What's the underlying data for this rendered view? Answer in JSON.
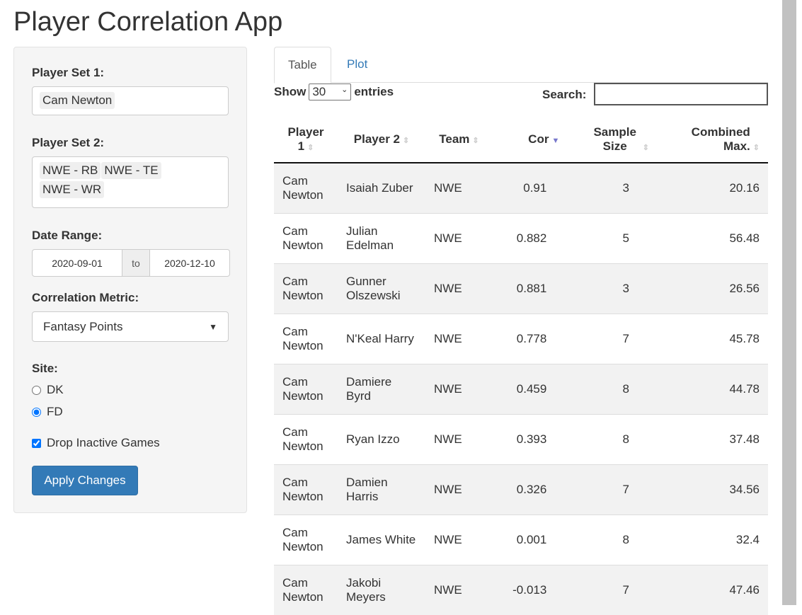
{
  "title": "Player Correlation App",
  "sidebar": {
    "set1_label": "Player Set 1:",
    "set1": [
      "Cam Newton"
    ],
    "set2_label": "Player Set 2:",
    "set2": [
      "NWE - RB",
      "NWE - TE",
      "NWE - WR"
    ],
    "date_label": "Date Range:",
    "date_start": "2020-09-01",
    "date_to": "to",
    "date_end": "2020-12-10",
    "metric_label": "Correlation Metric:",
    "metric": "Fantasy Points",
    "site_label": "Site:",
    "site_options": [
      "DK",
      "FD"
    ],
    "site_selected": "FD",
    "drop_label": "Drop Inactive Games",
    "drop_checked": true,
    "apply": "Apply Changes"
  },
  "tabs": [
    "Table",
    "Plot"
  ],
  "table": {
    "show": "Show",
    "length": "30",
    "entries": "entries",
    "search": "Search:",
    "columns": [
      "Player 1",
      "Player 2",
      "Team",
      "Cor",
      "Sample Size",
      "Combined Max."
    ],
    "rows": [
      [
        "Cam Newton",
        "Isaiah Zuber",
        "NWE",
        "0.91",
        "3",
        "20.16"
      ],
      [
        "Cam Newton",
        "Julian Edelman",
        "NWE",
        "0.882",
        "5",
        "56.48"
      ],
      [
        "Cam Newton",
        "Gunner Olszewski",
        "NWE",
        "0.881",
        "3",
        "26.56"
      ],
      [
        "Cam Newton",
        "N'Keal Harry",
        "NWE",
        "0.778",
        "7",
        "45.78"
      ],
      [
        "Cam Newton",
        "Damiere Byrd",
        "NWE",
        "0.459",
        "8",
        "44.78"
      ],
      [
        "Cam Newton",
        "Ryan Izzo",
        "NWE",
        "0.393",
        "8",
        "37.48"
      ],
      [
        "Cam Newton",
        "Damien Harris",
        "NWE",
        "0.326",
        "7",
        "34.56"
      ],
      [
        "Cam Newton",
        "James White",
        "NWE",
        "0.001",
        "8",
        "32.4"
      ],
      [
        "Cam Newton",
        "Jakobi Meyers",
        "NWE",
        "-0.013",
        "7",
        "47.46"
      ]
    ]
  },
  "colors": {
    "primary": "#337ab7",
    "sort_active": "#7777cc"
  }
}
